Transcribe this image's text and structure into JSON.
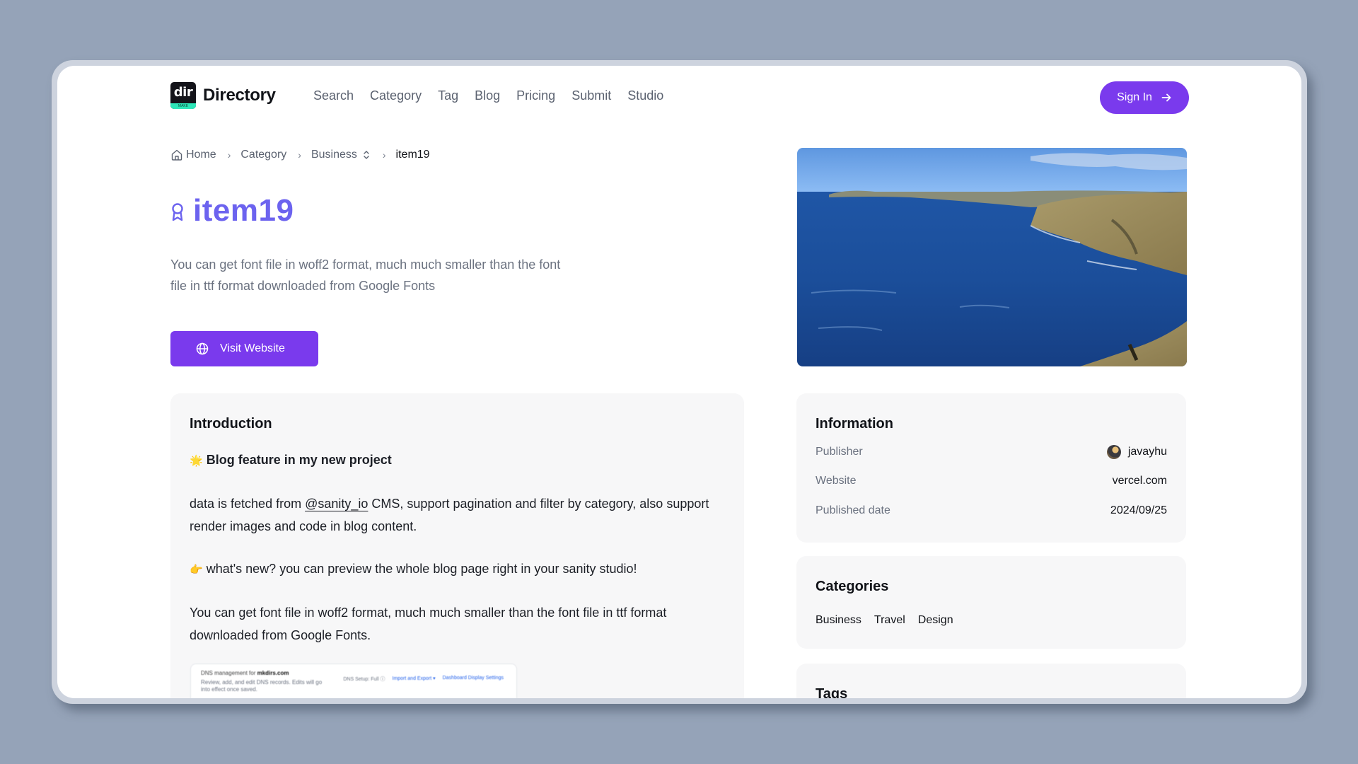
{
  "nav": {
    "logo_mark": "dir",
    "logo_sub": "MAKE",
    "brand": "Directory",
    "items": [
      "Search",
      "Category",
      "Tag",
      "Blog",
      "Pricing",
      "Submit",
      "Studio"
    ],
    "signin_label": "Sign In",
    "accent": "#7a3aed"
  },
  "breadcrumb": {
    "home": "Home",
    "category": "Category",
    "business": "Business",
    "current": "item19"
  },
  "item": {
    "title": "item19",
    "description": "You can get font file in woff2 format, much much smaller than the font file in ttf format downloaded from Google Fonts",
    "visit_label": "Visit Website",
    "title_color": "#6c63ef"
  },
  "introduction": {
    "heading": "Introduction",
    "feature_emoji": "🌟",
    "feature_title": "Blog feature in my new project",
    "p1_before": "data is fetched from ",
    "p1_link": "@sanity_io",
    "p1_after": " CMS, support pagination and filter by category, also support render images and code in blog content.",
    "p2_emoji": "👉",
    "p2": "what's new? you can preview the whole blog page right in your sanity studio!",
    "p3": "You can get font file in woff2 format, much much smaller than the font file in ttf format downloaded from Google Fonts.",
    "embed": {
      "title_prefix": "DNS management for ",
      "title_domain": "mkdirs.com",
      "subtitle": "Review, add, and edit DNS records. Edits will go into effect once saved.",
      "dns_setup": "DNS Setup: Full ⓘ",
      "import_export": "Import and Export ▾",
      "dashboard_settings": "Dashboard Display Settings"
    }
  },
  "information": {
    "heading": "Information",
    "rows": [
      {
        "label": "Publisher",
        "value": "javayhu"
      },
      {
        "label": "Website",
        "value": "vercel.com"
      },
      {
        "label": "Published date",
        "value": "2024/09/25"
      }
    ]
  },
  "categories": {
    "heading": "Categories",
    "items": [
      "Business",
      "Travel",
      "Design"
    ]
  },
  "tags": {
    "heading": "Tags"
  }
}
